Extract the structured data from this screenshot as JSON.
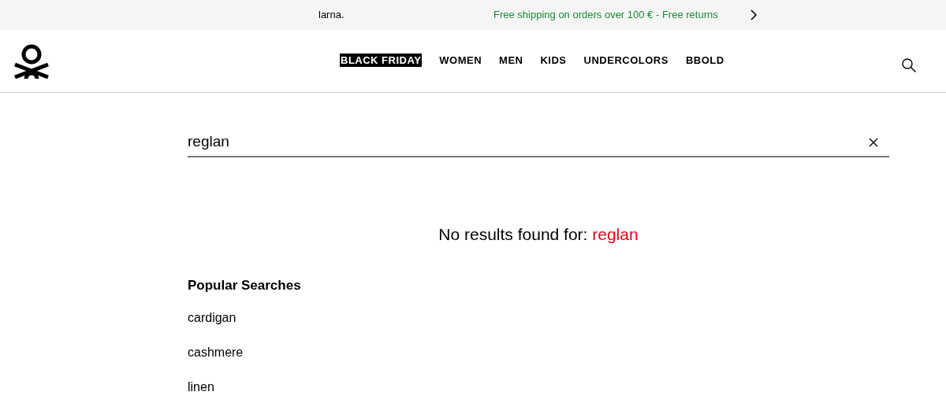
{
  "promo_bar": {
    "left_text": "larna.",
    "message": "Free shipping on orders over 100 € - Free returns"
  },
  "nav": [
    {
      "label": "BLACK FRIDAY",
      "highlighted": true
    },
    {
      "label": "WOMEN",
      "highlighted": false
    },
    {
      "label": "MEN",
      "highlighted": false
    },
    {
      "label": "KIDS",
      "highlighted": false
    },
    {
      "label": "UNDERCOLORS",
      "highlighted": false
    },
    {
      "label": "BBOLD",
      "highlighted": false
    }
  ],
  "search": {
    "value": "reglan"
  },
  "no_results": {
    "label": "No results found for:",
    "query": "reglan"
  },
  "popular_searches": {
    "title": "Popular Searches",
    "items": [
      "cardigan",
      "cashmere",
      "linen"
    ]
  }
}
